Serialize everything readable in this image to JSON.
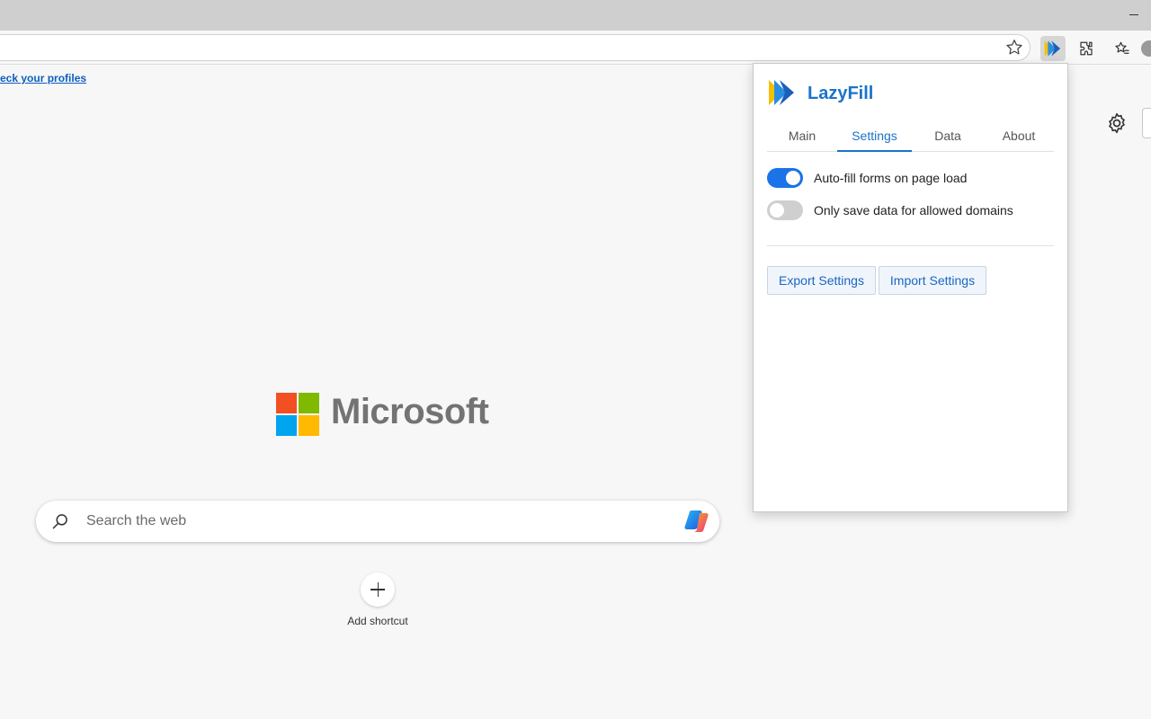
{
  "browser": {
    "infobar_link": "eck your profiles",
    "search_placeholder": "Search the web",
    "brand_name": "Microsoft",
    "add_shortcut_label": "Add shortcut"
  },
  "popup": {
    "title": "LazyFill",
    "tabs": [
      {
        "label": "Main",
        "active": false
      },
      {
        "label": "Settings",
        "active": true
      },
      {
        "label": "Data",
        "active": false
      },
      {
        "label": "About",
        "active": false
      }
    ],
    "settings": [
      {
        "label": "Auto-fill forms on page load",
        "enabled": true
      },
      {
        "label": "Only save data for allowed domains",
        "enabled": false
      }
    ],
    "buttons": {
      "export": "Export Settings",
      "import": "Import Settings"
    }
  },
  "colors": {
    "accent": "#1a73c9",
    "toggle_on": "#1a73e8",
    "toggle_off": "#cfcfcf"
  }
}
